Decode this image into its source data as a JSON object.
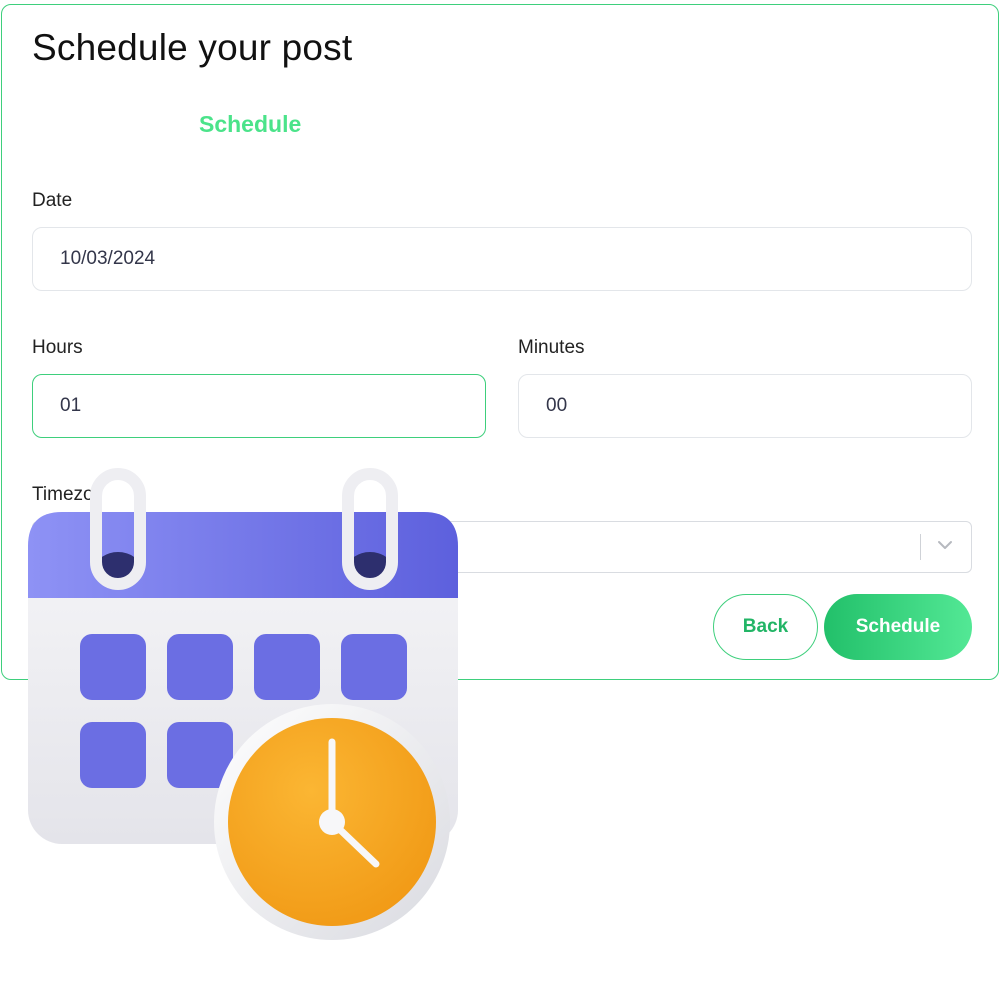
{
  "header": {
    "title": "Schedule your post"
  },
  "tabs": [
    {
      "label": "Schedule",
      "active": true
    }
  ],
  "form": {
    "date": {
      "label": "Date",
      "value": "10/03/2024"
    },
    "hours": {
      "label": "Hours",
      "value": "01"
    },
    "minutes": {
      "label": "Minutes",
      "value": "00"
    },
    "timezone": {
      "label": "Timezo",
      "value": ""
    }
  },
  "actions": {
    "back_label": "Back",
    "schedule_label": "Schedule"
  },
  "colors": {
    "accent": "#3ecf7c",
    "tab_text": "#4be38a",
    "calendar_purple": "#6b6ee3",
    "clock_orange": "#f5a21e"
  },
  "icons": {
    "select_chevron": "chevron-down-icon",
    "illustration": "calendar-clock-icon"
  }
}
